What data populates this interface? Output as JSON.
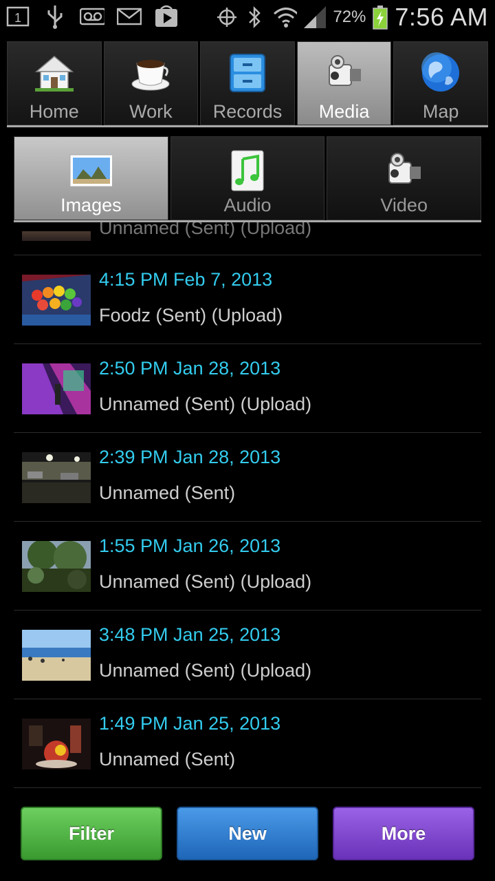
{
  "status_bar": {
    "sim_slot": "1",
    "battery_percent": "72%",
    "time": "7:56 AM"
  },
  "top_tabs": [
    {
      "label": "Home",
      "icon": "house-icon"
    },
    {
      "label": "Work",
      "icon": "coffee-cup-icon"
    },
    {
      "label": "Records",
      "icon": "file-cabinet-icon"
    },
    {
      "label": "Media",
      "icon": "video-camera-icon",
      "active": true
    },
    {
      "label": "Map",
      "icon": "globe-icon"
    }
  ],
  "sub_tabs": [
    {
      "label": "Images",
      "icon": "picture-icon",
      "active": true
    },
    {
      "label": "Audio",
      "icon": "music-note-icon"
    },
    {
      "label": "Video",
      "icon": "video-camera-icon"
    }
  ],
  "media_list": [
    {
      "timestamp": "",
      "description": "Unnamed (Sent) (Upload)",
      "partial": true
    },
    {
      "timestamp": "4:15 PM Feb 7, 2013",
      "description": "Foodz (Sent) (Upload)"
    },
    {
      "timestamp": "2:50 PM Jan 28, 2013",
      "description": "Unnamed (Sent) (Upload)"
    },
    {
      "timestamp": "2:39 PM Jan 28, 2013",
      "description": "Unnamed (Sent)"
    },
    {
      "timestamp": "1:55 PM Jan 26, 2013",
      "description": "Unnamed (Sent) (Upload)"
    },
    {
      "timestamp": "3:48 PM Jan 25, 2013",
      "description": "Unnamed (Sent) (Upload)"
    },
    {
      "timestamp": "1:49 PM Jan 25, 2013",
      "description": "Unnamed (Sent)"
    }
  ],
  "buttons": {
    "filter_label": "Filter",
    "new_label": "New",
    "more_label": "More"
  },
  "colors": {
    "timestamp": "#33ccee",
    "filter": "#4caf3f",
    "new": "#2a7bd1",
    "more": "#7d45cf"
  }
}
